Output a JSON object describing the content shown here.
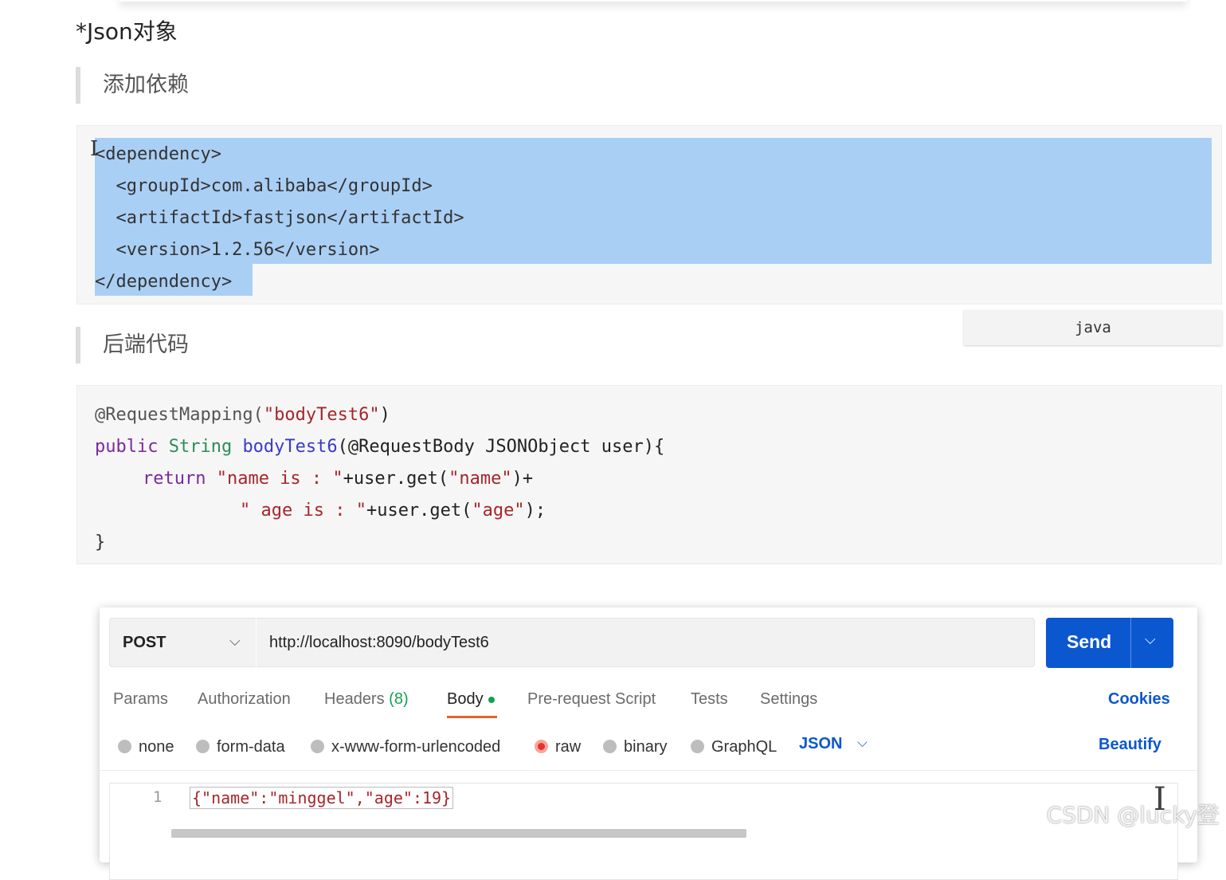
{
  "doc": {
    "heading": "*Json对象",
    "quote_dependency": "添加依赖",
    "quote_backend": "后端代码",
    "dependency_lines": [
      "<dependency>",
      "  <groupId>com.alibaba</groupId>",
      "  <artifactId>fastjson</artifactId>",
      "  <version>1.2.56</version>",
      "</dependency>"
    ],
    "lang_tag": "java",
    "java_code": {
      "l1_annotation": "@RequestMapping(",
      "l1_string": "\"bodyTest6\"",
      "l1_close": ")",
      "l2_public": "public ",
      "l2_type": "String ",
      "l2_method": "bodyTest6",
      "l2_rest": "(@RequestBody JSONObject user){",
      "l3_return": "return ",
      "l3_string1": "\"name is : \"",
      "l3_mid": "+user.get(",
      "l3_string2": "\"name\"",
      "l3_end": ")+",
      "l4_string1": "\" age is : \"",
      "l4_mid": "+user.get(",
      "l4_string2": "\"age\"",
      "l4_end": ");",
      "l5": "}"
    }
  },
  "postman": {
    "method": "POST",
    "url": "http://localhost:8090/bodyTest6",
    "send_label": "Send",
    "tabs": {
      "params": "Params",
      "authorization": "Authorization",
      "headers": "Headers",
      "headers_count": "(8)",
      "body": "Body",
      "prerequest": "Pre-request Script",
      "tests": "Tests",
      "settings": "Settings"
    },
    "cookies": "Cookies",
    "body_types": {
      "none": "none",
      "form_data": "form-data",
      "urlencoded": "x-www-form-urlencoded",
      "raw": "raw",
      "binary": "binary",
      "graphql": "GraphQL"
    },
    "raw_format": "JSON",
    "beautify": "Beautify",
    "editor": {
      "line_number": "1",
      "content": "{\"name\":\"minggel\",\"age\":19}"
    }
  },
  "watermark": "CSDN @lucky登"
}
